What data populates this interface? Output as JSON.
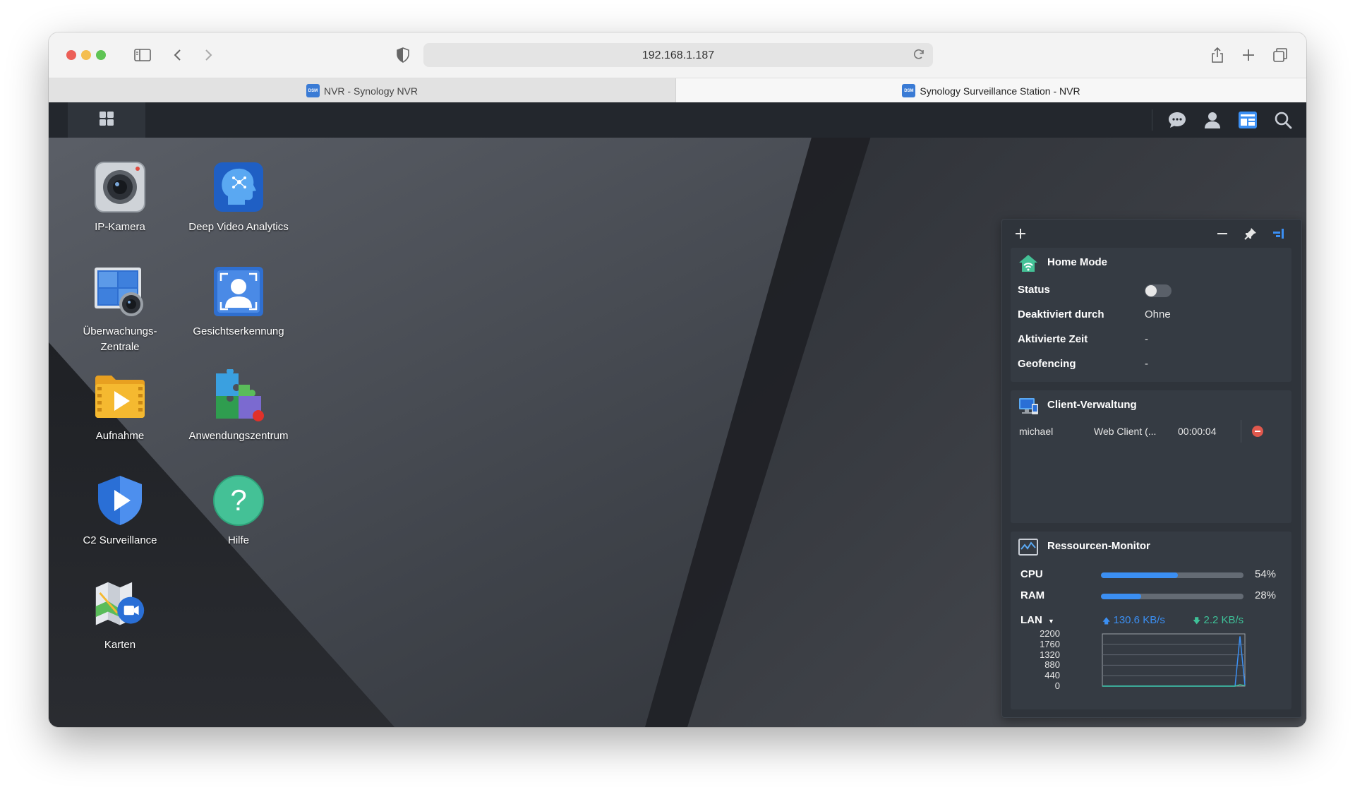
{
  "browser": {
    "url": "192.168.1.187",
    "tabs": [
      {
        "title": "NVR - Synology NVR",
        "favicon": "DSM",
        "active": false
      },
      {
        "title": "Synology Surveillance Station - NVR",
        "favicon": "DSM",
        "active": true
      }
    ],
    "toolbar_icons": [
      "sidebar-icon",
      "back-icon",
      "forward-icon",
      "shield-icon",
      "reload-icon",
      "share-icon",
      "new-tab-icon",
      "tab-overview-icon"
    ]
  },
  "taskbar": {
    "main_menu_icon": "grid-icon",
    "right_icons": [
      "chat-icon",
      "user-icon",
      "widgets-icon",
      "search-icon"
    ]
  },
  "desktop": {
    "icons": [
      {
        "label": "IP-Kamera",
        "icon": "ip-camera-icon"
      },
      {
        "label": "Deep Video Analytics",
        "icon": "deep-video-analytics-icon"
      },
      {
        "label": "Überwachungs-\nZentrale",
        "icon": "monitor-center-icon"
      },
      {
        "label": "Gesichtserkennung",
        "icon": "face-recognition-icon"
      },
      {
        "label": "Aufnahme",
        "icon": "recording-folder-icon"
      },
      {
        "label": "Anwendungszentrum",
        "icon": "application-center-icon"
      },
      {
        "label": "C2 Surveillance",
        "icon": "c2-surveillance-icon"
      },
      {
        "label": "Hilfe",
        "icon": "help-icon"
      },
      {
        "label": "Karten",
        "icon": "maps-icon"
      }
    ]
  },
  "widget_panel": {
    "header_icons": [
      "add-icon",
      "minimize-icon",
      "pin-icon",
      "panel-toggle-icon"
    ],
    "home_mode": {
      "title": "Home Mode",
      "rows": [
        {
          "label": "Status",
          "value": "",
          "toggle": false
        },
        {
          "label": "Deaktiviert durch",
          "value": "Ohne"
        },
        {
          "label": "Aktivierte Zeit",
          "value": "-"
        },
        {
          "label": "Geofencing",
          "value": "-"
        }
      ]
    },
    "client_management": {
      "title": "Client-Verwaltung",
      "rows": [
        {
          "user": "michael",
          "client": "Web Client (...",
          "time": "00:00:04"
        }
      ]
    },
    "resource_monitor": {
      "title": "Ressourcen-Monitor",
      "cpu": {
        "label": "CPU",
        "percent": 54,
        "text": "54%"
      },
      "ram": {
        "label": "RAM",
        "percent": 28,
        "text": "28%"
      },
      "lan": {
        "label": "LAN",
        "upload": "130.6 KB/s",
        "download": "2.2 KB/s"
      },
      "colors": {
        "upload": "#3b8ff3",
        "download": "#3ec198",
        "bar": "#3b8ff3"
      }
    }
  },
  "chart_data": {
    "type": "line",
    "title": "",
    "xlabel": "",
    "ylabel": "",
    "ylim": [
      0,
      2200
    ],
    "yticks": [
      "2200",
      "1760",
      "1320",
      "880",
      "440",
      "0"
    ],
    "x": [
      0,
      1,
      2,
      3,
      4,
      5,
      6,
      7,
      8,
      9,
      10,
      11,
      12,
      13,
      14,
      15,
      16,
      17,
      18,
      19,
      20,
      21,
      22,
      23,
      24,
      25,
      26,
      27,
      28,
      29
    ],
    "series": [
      {
        "values": [
          0,
          0,
          0,
          0,
          0,
          0,
          0,
          0,
          0,
          0,
          0,
          0,
          0,
          0,
          0,
          0,
          0,
          0,
          0,
          0,
          0,
          0,
          0,
          0,
          0,
          0,
          0,
          0,
          2100,
          50
        ],
        "color": "#3b8ff3"
      },
      {
        "values": [
          0,
          0,
          0,
          0,
          0,
          0,
          0,
          0,
          0,
          0,
          0,
          0,
          0,
          0,
          0,
          0,
          0,
          0,
          0,
          0,
          0,
          0,
          0,
          0,
          0,
          0,
          0,
          0,
          60,
          20
        ],
        "color": "#3ec198"
      }
    ],
    "grid": true
  }
}
